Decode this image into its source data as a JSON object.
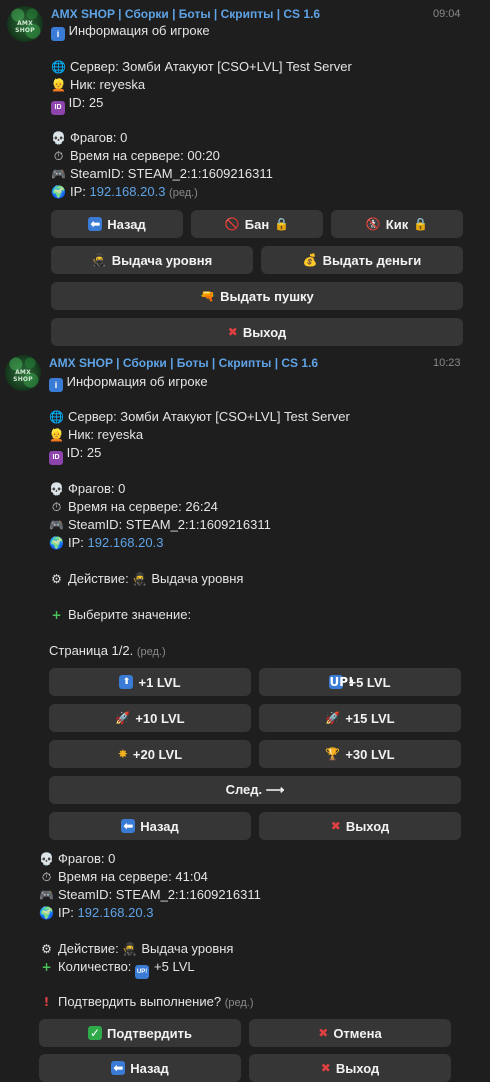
{
  "message1": {
    "sender": "AMX SHOP | Сборки | Боты | Скрипты | CS 1.6",
    "time": "09:04",
    "avatar_text": "AMX SHOP",
    "title": "Информация об игроке",
    "server": "Сервер: Зомби Атакуют [CSO+LVL] Test Server",
    "nick": "Ник: reyeska",
    "id": "ID: 25",
    "frags": "Фрагов: 0",
    "time_on_server": "Время на сервере: 00:20",
    "steamid": "SteamID: STEAM_2:1:1609216311",
    "ip_label": "IP: ",
    "ip": "192.168.20.3",
    "edited": "(ред.)",
    "buttons": {
      "back": "Назад",
      "ban": "Бан",
      "kick": "Кик",
      "give_level": "Выдача уровня",
      "give_money": "Выдать деньги",
      "give_gun": "Выдать пушку",
      "exit": "Выход"
    }
  },
  "message2": {
    "sender": "AMX SHOP | Сборки | Боты | Скрипты | CS 1.6",
    "time": "10:23",
    "avatar_text": "AMX SHOP",
    "title": "Информация об игроке",
    "server": "Сервер: Зомби Атакуют [CSO+LVL] Test Server",
    "nick": "Ник: reyeska",
    "id": "ID: 25",
    "frags": "Фрагов: 0",
    "time_on_server": "Время на сервере: 26:24",
    "steamid": "SteamID: STEAM_2:1:1609216311",
    "ip_label": "IP: ",
    "ip": "192.168.20.3",
    "action": "Действие: ",
    "action_value": "Выдача уровня",
    "choose": "Выберите значение:",
    "page": "Страница 1/2.",
    "edited": "(ред.)",
    "buttons": {
      "lvl1": "+1 LVL",
      "lvl5": "+5 LVL",
      "lvl10": "+10 LVL",
      "lvl15": "+15 LVL",
      "lvl20": "+20 LVL",
      "lvl30": "+30 LVL",
      "next": "След. ⟶",
      "back": "Назад",
      "exit": "Выход"
    }
  },
  "message3": {
    "frags": "Фрагов: 0",
    "time_on_server": "Время на сервере: 41:04",
    "steamid": "SteamID: STEAM_2:1:1609216311",
    "ip_label": "IP: ",
    "ip": "192.168.20.3",
    "action": "Действие: ",
    "action_value": "Выдача уровня",
    "amount": "Количество: ",
    "amount_value": "+5 LVL",
    "confirm_q": "Подтвердить выполнение?",
    "edited": "(ред.)",
    "buttons": {
      "confirm": "Подтвердить",
      "cancel": "Отмена",
      "back": "Назад",
      "exit": "Выход"
    }
  },
  "colors": {
    "background": "#1e1e1e",
    "button": "#363636",
    "sender": "#5fa3e6",
    "link": "#5fa3e6"
  }
}
